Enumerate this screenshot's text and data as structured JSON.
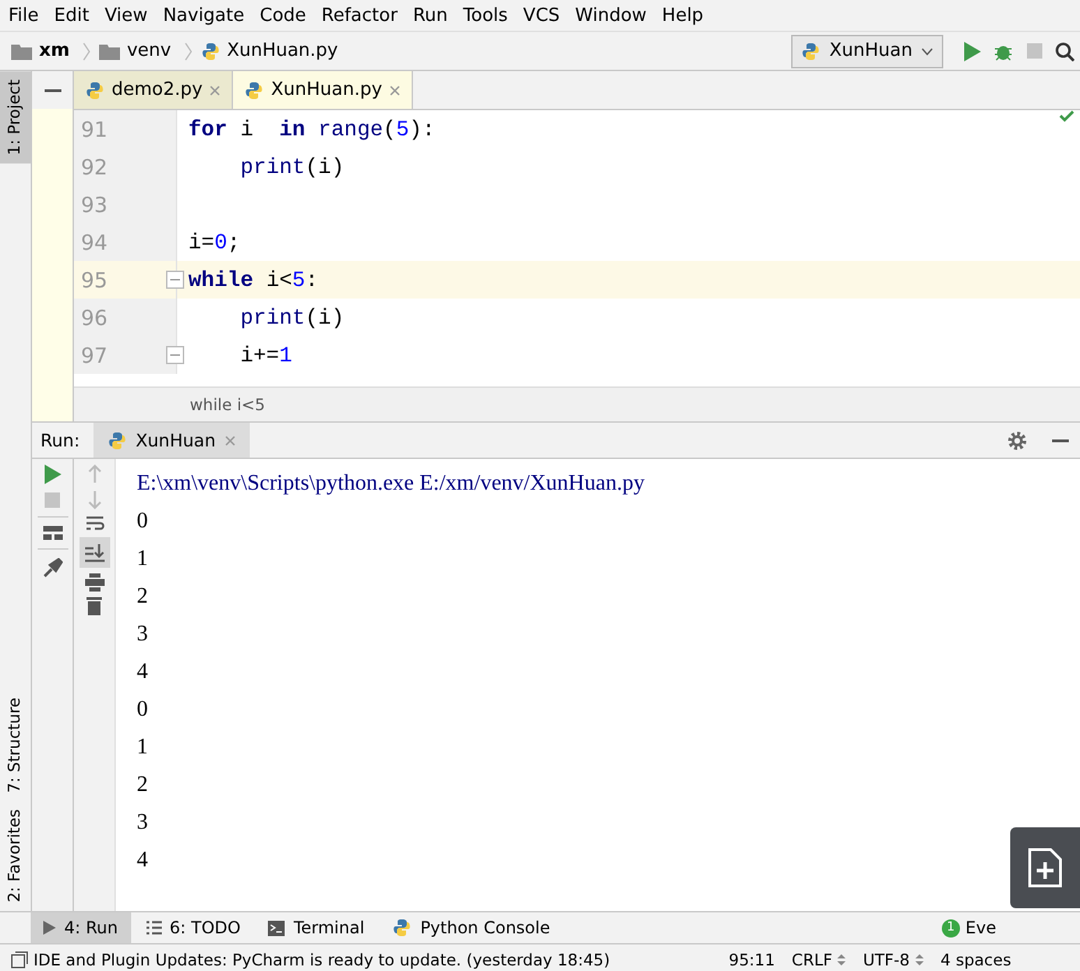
{
  "menu": [
    "File",
    "Edit",
    "View",
    "Navigate",
    "Code",
    "Refactor",
    "Run",
    "Tools",
    "VCS",
    "Window",
    "Help"
  ],
  "breadcrumb": [
    {
      "label": "xm",
      "kind": "root"
    },
    {
      "label": "venv",
      "kind": "folder"
    },
    {
      "label": "XunHuan.py",
      "kind": "file"
    }
  ],
  "run_config": "XunHuan",
  "left_tool_tabs": [
    {
      "label": "1: Project",
      "selected": true
    },
    {
      "label": "7: Structure",
      "selected": false
    },
    {
      "label": "2: Favorites",
      "selected": false
    }
  ],
  "editor_tabs": [
    {
      "label": "demo2.py",
      "selected": false
    },
    {
      "label": "XunHuan.py",
      "selected": true
    }
  ],
  "code_lines": [
    {
      "number": "91",
      "current": false,
      "fold": false,
      "tokens": [
        {
          "text": "for",
          "kind": "keyword"
        },
        {
          "text": " i  ",
          "kind": "plain"
        },
        {
          "text": "in",
          "kind": "keyword"
        },
        {
          "text": " range",
          "kind": "builtin"
        },
        {
          "text": "(",
          "kind": "plain"
        },
        {
          "text": "5",
          "kind": "number"
        },
        {
          "text": "):",
          "kind": "plain"
        }
      ]
    },
    {
      "number": "92",
      "current": false,
      "fold": false,
      "tokens": [
        {
          "text": "    print",
          "kind": "builtin"
        },
        {
          "text": "(i)",
          "kind": "plain"
        }
      ]
    },
    {
      "number": "93",
      "current": false,
      "fold": false
    },
    {
      "number": "94",
      "current": false,
      "fold": false,
      "tokens": [
        {
          "text": "i=",
          "kind": "plain"
        },
        {
          "text": "0",
          "kind": "number"
        },
        {
          "text": ";",
          "kind": "plain"
        }
      ]
    },
    {
      "number": "95",
      "current": true,
      "fold": true,
      "tokens": [
        {
          "text": "while",
          "kind": "keyword"
        },
        {
          "text": " i<",
          "kind": "plain"
        },
        {
          "text": "5",
          "kind": "number"
        },
        {
          "text": ":",
          "kind": "plain"
        }
      ]
    },
    {
      "number": "96",
      "current": false,
      "fold": false,
      "tokens": [
        {
          "text": "    print",
          "kind": "builtin"
        },
        {
          "text": "(i)",
          "kind": "plain"
        }
      ]
    },
    {
      "number": "97",
      "current": false,
      "fold": true,
      "tokens": [
        {
          "text": "    i+=",
          "kind": "plain"
        },
        {
          "text": "1",
          "kind": "number"
        }
      ]
    }
  ],
  "editor_breadcrumb": "while i<5",
  "run_panel": {
    "title": "Run:",
    "tab": "XunHuan",
    "output": [
      {
        "text": "E:\\xm\\venv\\Scripts\\python.exe E:/xm/venv/XunHuan.py",
        "kind": "command"
      },
      {
        "text": "0",
        "kind": "output"
      },
      {
        "text": "1",
        "kind": "output"
      },
      {
        "text": "2",
        "kind": "output"
      },
      {
        "text": "3",
        "kind": "output"
      },
      {
        "text": "4",
        "kind": "output"
      },
      {
        "text": "0",
        "kind": "output"
      },
      {
        "text": "1",
        "kind": "output"
      },
      {
        "text": "2",
        "kind": "output"
      },
      {
        "text": "3",
        "kind": "output"
      },
      {
        "text": "4",
        "kind": "output"
      }
    ]
  },
  "bottom_tabs": [
    {
      "label": "4: Run",
      "kind": "run",
      "selected": true
    },
    {
      "label": "6: TODO",
      "kind": "todo",
      "selected": false
    },
    {
      "label": "Terminal",
      "kind": "terminal",
      "selected": false
    },
    {
      "label": "Python Console",
      "kind": "console",
      "selected": false
    }
  ],
  "event_log": {
    "label": "Eve",
    "count": "1"
  },
  "status_bar": {
    "message": "IDE and Plugin Updates: PyCharm is ready to update. (yesterday 18:45)",
    "position": "95:11",
    "line_separator": "CRLF",
    "encoding": "UTF-8",
    "indent": "4 spaces"
  }
}
